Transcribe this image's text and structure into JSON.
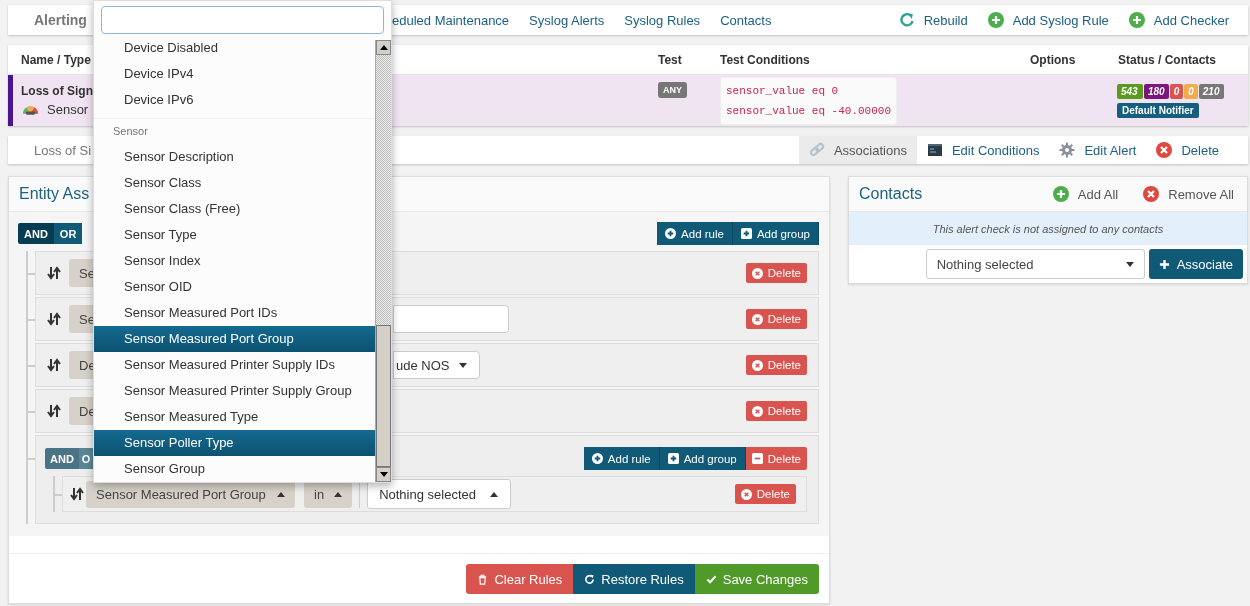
{
  "nav": {
    "title": "Alerting",
    "links": [
      "eduled Maintenance",
      "Syslog Alerts",
      "Syslog Rules",
      "Contacts"
    ],
    "actions": [
      {
        "label": "Rebuild",
        "kind": "refresh"
      },
      {
        "label": "Add Syslog Rule",
        "kind": "add"
      },
      {
        "label": "Add Checker",
        "kind": "add"
      }
    ]
  },
  "table": {
    "columns": [
      "Name / Type",
      "Test",
      "Test Conditions",
      "Options",
      "Status / Contacts"
    ],
    "row": {
      "name": "Loss of Sign",
      "type": "Sensor",
      "test": "ANY",
      "conditions": [
        "sensor_value eq 0",
        "sensor_value eq -40.00000"
      ],
      "counts": [
        {
          "text": "543",
          "color": "#5b9a1f"
        },
        {
          "text": "180",
          "color": "#7a1778"
        },
        {
          "text": "0",
          "color": "#d9534f"
        },
        {
          "text": "0",
          "color": "#f0ad4e"
        },
        {
          "text": "210",
          "color": "#777777"
        }
      ],
      "contact": "Default Notifier"
    }
  },
  "alert_bar": {
    "title": "Loss of Si",
    "actions": [
      {
        "label": "Associations",
        "kind": "link",
        "selected": true
      },
      {
        "label": "Edit Conditions",
        "kind": "terminal",
        "selected": false
      },
      {
        "label": "Edit Alert",
        "kind": "gear",
        "selected": false
      },
      {
        "label": "Delete",
        "kind": "delete",
        "selected": false
      }
    ]
  },
  "entity_panel": {
    "title": "Entity Ass",
    "group": {
      "conjunctions": [
        {
          "label": "AND",
          "selected": true
        },
        {
          "label": "OR",
          "selected": false
        }
      ],
      "disabled": false,
      "buttons": [
        "Add rule",
        "Add group"
      ],
      "rules": [
        {
          "kind": "rule",
          "field": "Se",
          "delete": "Delete"
        },
        {
          "kind": "rule",
          "field": "Se",
          "value": {
            "kind": "input"
          },
          "delete": "Delete"
        },
        {
          "kind": "rule",
          "field": "De",
          "value": {
            "kind": "select",
            "text": "ude NOS",
            "open": false
          },
          "delete": "Delete"
        },
        {
          "kind": "rule",
          "field": "De",
          "delete": "Delete"
        },
        {
          "kind": "group",
          "conjunctions": [
            {
              "label": "AND",
              "selected": true
            },
            {
              "label": "O",
              "selected": false
            }
          ],
          "disabled": true,
          "buttons": [
            "Add rule",
            "Add group"
          ],
          "delete": "Delete",
          "rules": [
            {
              "kind": "rule",
              "field": "Sensor Measured Port Group",
              "field_open": true,
              "operator": "in",
              "operator_open": true,
              "value": {
                "kind": "select",
                "text": "Nothing selected",
                "open": true
              },
              "delete": "Delete"
            }
          ]
        }
      ]
    },
    "footer": [
      {
        "label": "Clear Rules",
        "kind": "danger"
      },
      {
        "label": "Restore Rules",
        "kind": "primary"
      },
      {
        "label": "Save Changes",
        "kind": "success"
      }
    ]
  },
  "contacts_panel": {
    "title": "Contacts",
    "actions": [
      {
        "label": "Add All",
        "kind": "add"
      },
      {
        "label": "Remove All",
        "kind": "remove"
      }
    ],
    "notice": "This alert check is not assigned to any contacts",
    "select_placeholder": "Nothing selected",
    "button": "Associate"
  },
  "dropdown": {
    "options": [
      {
        "kind": "option",
        "label": "Device Disabled",
        "selected": false
      },
      {
        "kind": "option",
        "label": "Device IPv4",
        "selected": false
      },
      {
        "kind": "option",
        "label": "Device IPv6",
        "selected": false
      },
      {
        "kind": "header",
        "label": "Sensor"
      },
      {
        "kind": "option",
        "label": "Sensor Description",
        "selected": false
      },
      {
        "kind": "option",
        "label": "Sensor Class",
        "selected": false
      },
      {
        "kind": "option",
        "label": "Sensor Class (Free)",
        "selected": false
      },
      {
        "kind": "option",
        "label": "Sensor Type",
        "selected": false
      },
      {
        "kind": "option",
        "label": "Sensor Index",
        "selected": false
      },
      {
        "kind": "option",
        "label": "Sensor OID",
        "selected": false
      },
      {
        "kind": "option",
        "label": "Sensor Measured Port IDs",
        "selected": false
      },
      {
        "kind": "option",
        "label": "Sensor Measured Port Group",
        "selected": true
      },
      {
        "kind": "option",
        "label": "Sensor Measured Printer Supply IDs",
        "selected": false
      },
      {
        "kind": "option",
        "label": "Sensor Measured Printer Supply Group",
        "selected": false
      },
      {
        "kind": "option",
        "label": "Sensor Measured Type",
        "selected": false
      },
      {
        "kind": "option",
        "label": "Sensor Poller Type",
        "selected": true
      },
      {
        "kind": "option",
        "label": "Sensor Group",
        "selected": false
      }
    ]
  }
}
